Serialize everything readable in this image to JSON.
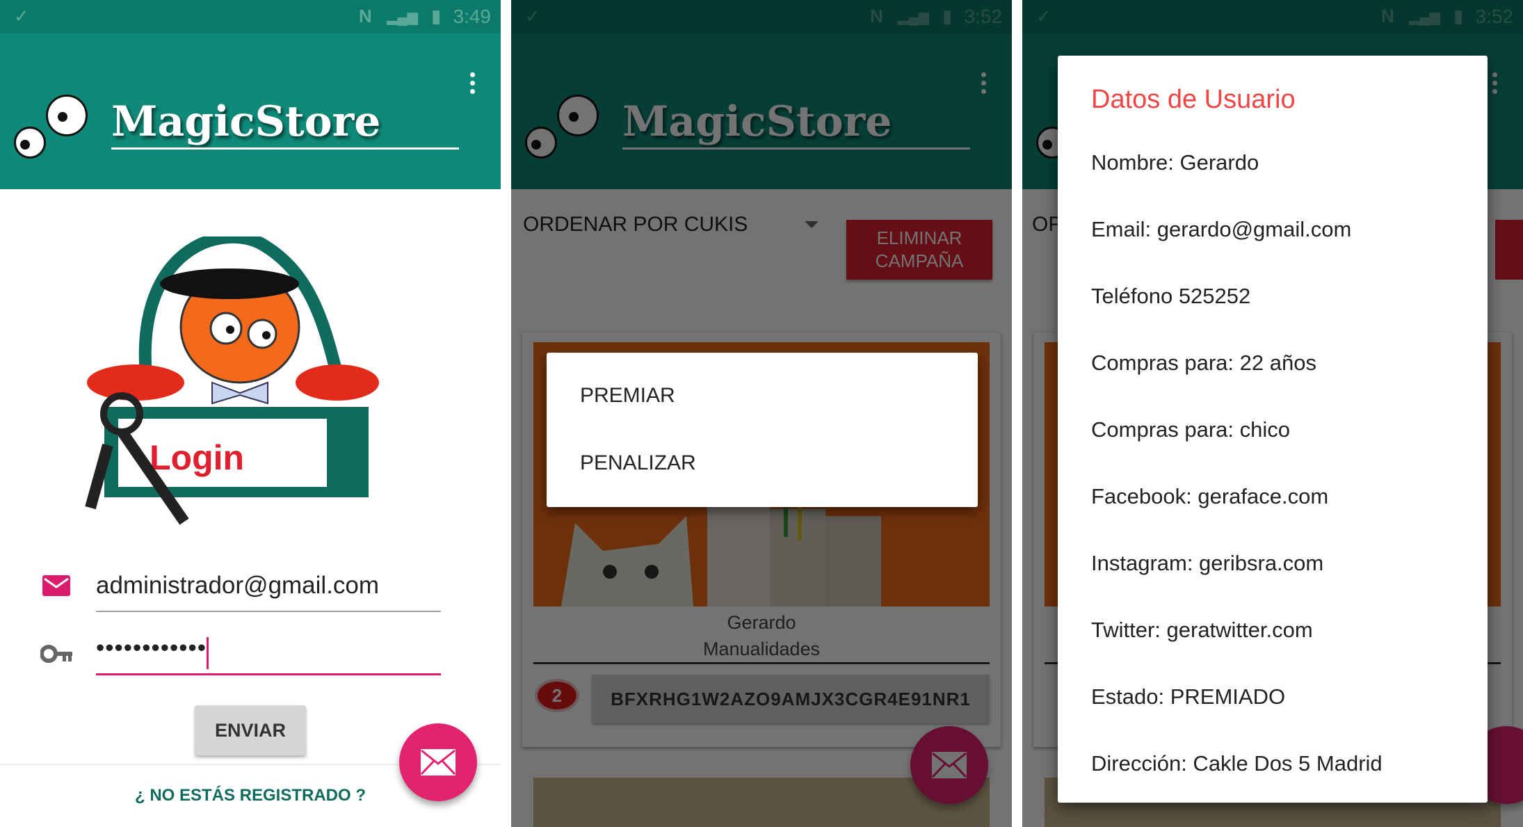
{
  "colors": {
    "primary": "#0f8a78",
    "status_bar": "#0c7a69",
    "accent": "#e2236f",
    "danger": "#e0202f",
    "dialog_title": "#ef4545"
  },
  "screen1": {
    "status_time": "3:49",
    "app_title": "MagicStore",
    "login_art_label": "Login",
    "email_value": "administrador@gmail.com",
    "password_value": "••••••••••••",
    "submit_label": "ENVIAR",
    "register_link": "¿ NO ESTÁS REGISTRADO ?",
    "icons": {
      "email": "mail-icon",
      "password": "key-icon",
      "fab": "envelope-icon",
      "menu": "overflow-menu-icon"
    }
  },
  "screen2": {
    "status_time": "3:52",
    "app_title": "MagicStore",
    "sort_label": "ORDENAR POR CUKIS",
    "delete_campaign_label": "ELIMINAR CAMPAÑA",
    "card": {
      "name": "Gerardo",
      "category": "Manualidades",
      "badge_count": "2",
      "code": "BFXRHG1W2AZO9AMJX3CGR4E91NR1"
    },
    "context_menu": [
      "PREMIAR",
      "PENALIZAR"
    ]
  },
  "screen3": {
    "status_time": "3:52",
    "behind_sort_fragment": "OF",
    "dialog_title": "Datos de Usuario",
    "fields": [
      "Nombre: Gerardo",
      "Email: gerardo@gmail.com",
      "Teléfono 525252",
      "Compras para: 22 años",
      "Compras para: chico",
      "Facebook: geraface.com",
      "Instagram: geribsra.com",
      "Twitter: geratwitter.com",
      "Estado: PREMIADO",
      "Dirección: Cakle Dos 5 Madrid"
    ]
  }
}
